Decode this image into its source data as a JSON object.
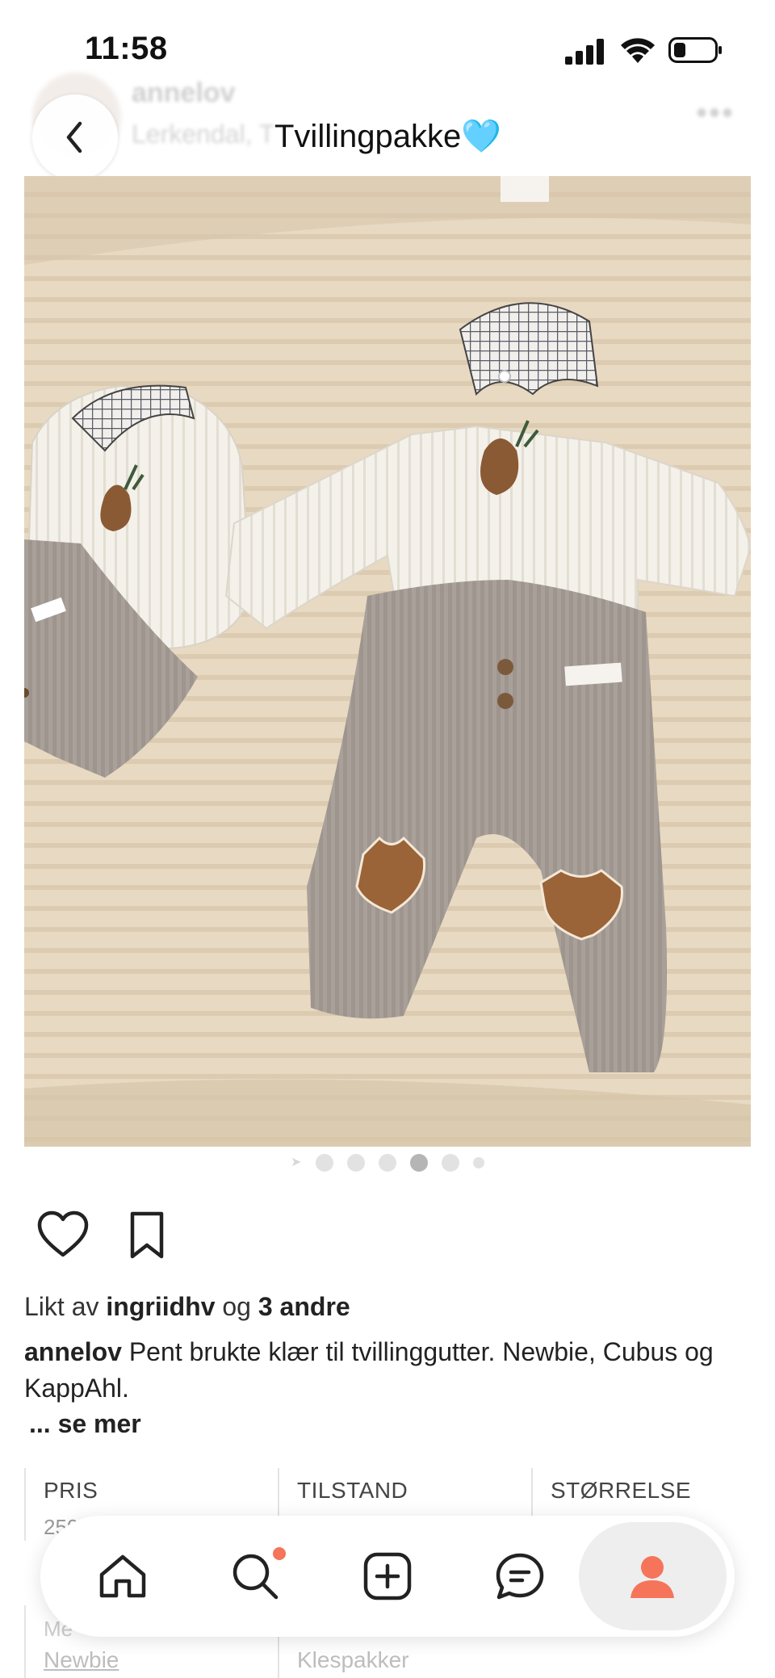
{
  "status_bar": {
    "time": "11:58",
    "icons": [
      "cellular-signal-icon",
      "wifi-icon",
      "battery-icon"
    ]
  },
  "header": {
    "title": "Tvillingpakke🩵",
    "ghost_username": "annelov",
    "ghost_location": "Lerkendal, T",
    "back_icon": "chevron-left-icon"
  },
  "carousel": {
    "count": 6,
    "active_index": 3
  },
  "actions": {
    "like_icon": "heart-icon",
    "save_icon": "bookmark-icon"
  },
  "likes": {
    "prefix": "Likt av",
    "user": "ingriidhv",
    "connector": "og",
    "others": "3 andre"
  },
  "caption": {
    "username": "annelov",
    "text": "Pent brukte klær til tvillinggutter. Newbie, Cubus og KappAhl.",
    "see_more": "... se mer"
  },
  "details": {
    "columns": [
      {
        "label": "PRIS",
        "value": "250"
      },
      {
        "label": "TILSTAND",
        "value": ""
      },
      {
        "label": "STØRRELSE",
        "value": ""
      }
    ],
    "row2": [
      {
        "label": "Me",
        "value": "Newbie"
      },
      {
        "label": "",
        "value": "Klespakker"
      }
    ]
  },
  "tab_bar": {
    "items": [
      {
        "name": "home",
        "icon": "home-icon"
      },
      {
        "name": "search",
        "icon": "search-icon",
        "badge": true
      },
      {
        "name": "add",
        "icon": "add-square-icon"
      },
      {
        "name": "messages",
        "icon": "chat-bubble-icon"
      },
      {
        "name": "profile",
        "icon": "profile-icon",
        "active": true
      }
    ],
    "accent_color": "#f5745a"
  }
}
